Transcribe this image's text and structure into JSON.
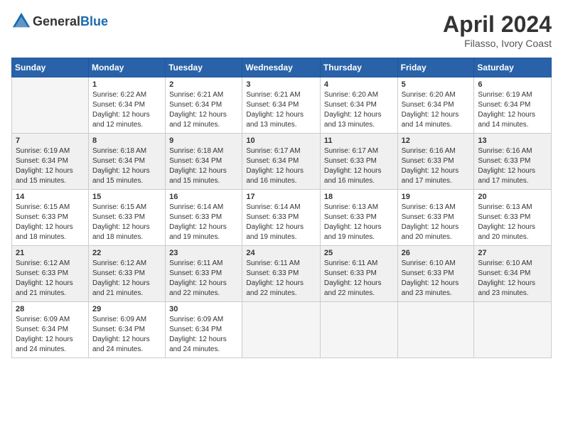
{
  "header": {
    "logo_general": "General",
    "logo_blue": "Blue",
    "month": "April 2024",
    "location": "Filasso, Ivory Coast"
  },
  "days_of_week": [
    "Sunday",
    "Monday",
    "Tuesday",
    "Wednesday",
    "Thursday",
    "Friday",
    "Saturday"
  ],
  "weeks": [
    {
      "days": [
        {
          "number": "",
          "sunrise": "",
          "sunset": "",
          "daylight": ""
        },
        {
          "number": "1",
          "sunrise": "Sunrise: 6:22 AM",
          "sunset": "Sunset: 6:34 PM",
          "daylight": "Daylight: 12 hours and 12 minutes."
        },
        {
          "number": "2",
          "sunrise": "Sunrise: 6:21 AM",
          "sunset": "Sunset: 6:34 PM",
          "daylight": "Daylight: 12 hours and 12 minutes."
        },
        {
          "number": "3",
          "sunrise": "Sunrise: 6:21 AM",
          "sunset": "Sunset: 6:34 PM",
          "daylight": "Daylight: 12 hours and 13 minutes."
        },
        {
          "number": "4",
          "sunrise": "Sunrise: 6:20 AM",
          "sunset": "Sunset: 6:34 PM",
          "daylight": "Daylight: 12 hours and 13 minutes."
        },
        {
          "number": "5",
          "sunrise": "Sunrise: 6:20 AM",
          "sunset": "Sunset: 6:34 PM",
          "daylight": "Daylight: 12 hours and 14 minutes."
        },
        {
          "number": "6",
          "sunrise": "Sunrise: 6:19 AM",
          "sunset": "Sunset: 6:34 PM",
          "daylight": "Daylight: 12 hours and 14 minutes."
        }
      ]
    },
    {
      "days": [
        {
          "number": "7",
          "sunrise": "Sunrise: 6:19 AM",
          "sunset": "Sunset: 6:34 PM",
          "daylight": "Daylight: 12 hours and 15 minutes."
        },
        {
          "number": "8",
          "sunrise": "Sunrise: 6:18 AM",
          "sunset": "Sunset: 6:34 PM",
          "daylight": "Daylight: 12 hours and 15 minutes."
        },
        {
          "number": "9",
          "sunrise": "Sunrise: 6:18 AM",
          "sunset": "Sunset: 6:34 PM",
          "daylight": "Daylight: 12 hours and 15 minutes."
        },
        {
          "number": "10",
          "sunrise": "Sunrise: 6:17 AM",
          "sunset": "Sunset: 6:34 PM",
          "daylight": "Daylight: 12 hours and 16 minutes."
        },
        {
          "number": "11",
          "sunrise": "Sunrise: 6:17 AM",
          "sunset": "Sunset: 6:33 PM",
          "daylight": "Daylight: 12 hours and 16 minutes."
        },
        {
          "number": "12",
          "sunrise": "Sunrise: 6:16 AM",
          "sunset": "Sunset: 6:33 PM",
          "daylight": "Daylight: 12 hours and 17 minutes."
        },
        {
          "number": "13",
          "sunrise": "Sunrise: 6:16 AM",
          "sunset": "Sunset: 6:33 PM",
          "daylight": "Daylight: 12 hours and 17 minutes."
        }
      ]
    },
    {
      "days": [
        {
          "number": "14",
          "sunrise": "Sunrise: 6:15 AM",
          "sunset": "Sunset: 6:33 PM",
          "daylight": "Daylight: 12 hours and 18 minutes."
        },
        {
          "number": "15",
          "sunrise": "Sunrise: 6:15 AM",
          "sunset": "Sunset: 6:33 PM",
          "daylight": "Daylight: 12 hours and 18 minutes."
        },
        {
          "number": "16",
          "sunrise": "Sunrise: 6:14 AM",
          "sunset": "Sunset: 6:33 PM",
          "daylight": "Daylight: 12 hours and 19 minutes."
        },
        {
          "number": "17",
          "sunrise": "Sunrise: 6:14 AM",
          "sunset": "Sunset: 6:33 PM",
          "daylight": "Daylight: 12 hours and 19 minutes."
        },
        {
          "number": "18",
          "sunrise": "Sunrise: 6:13 AM",
          "sunset": "Sunset: 6:33 PM",
          "daylight": "Daylight: 12 hours and 19 minutes."
        },
        {
          "number": "19",
          "sunrise": "Sunrise: 6:13 AM",
          "sunset": "Sunset: 6:33 PM",
          "daylight": "Daylight: 12 hours and 20 minutes."
        },
        {
          "number": "20",
          "sunrise": "Sunrise: 6:13 AM",
          "sunset": "Sunset: 6:33 PM",
          "daylight": "Daylight: 12 hours and 20 minutes."
        }
      ]
    },
    {
      "days": [
        {
          "number": "21",
          "sunrise": "Sunrise: 6:12 AM",
          "sunset": "Sunset: 6:33 PM",
          "daylight": "Daylight: 12 hours and 21 minutes."
        },
        {
          "number": "22",
          "sunrise": "Sunrise: 6:12 AM",
          "sunset": "Sunset: 6:33 PM",
          "daylight": "Daylight: 12 hours and 21 minutes."
        },
        {
          "number": "23",
          "sunrise": "Sunrise: 6:11 AM",
          "sunset": "Sunset: 6:33 PM",
          "daylight": "Daylight: 12 hours and 22 minutes."
        },
        {
          "number": "24",
          "sunrise": "Sunrise: 6:11 AM",
          "sunset": "Sunset: 6:33 PM",
          "daylight": "Daylight: 12 hours and 22 minutes."
        },
        {
          "number": "25",
          "sunrise": "Sunrise: 6:11 AM",
          "sunset": "Sunset: 6:33 PM",
          "daylight": "Daylight: 12 hours and 22 minutes."
        },
        {
          "number": "26",
          "sunrise": "Sunrise: 6:10 AM",
          "sunset": "Sunset: 6:33 PM",
          "daylight": "Daylight: 12 hours and 23 minutes."
        },
        {
          "number": "27",
          "sunrise": "Sunrise: 6:10 AM",
          "sunset": "Sunset: 6:34 PM",
          "daylight": "Daylight: 12 hours and 23 minutes."
        }
      ]
    },
    {
      "days": [
        {
          "number": "28",
          "sunrise": "Sunrise: 6:09 AM",
          "sunset": "Sunset: 6:34 PM",
          "daylight": "Daylight: 12 hours and 24 minutes."
        },
        {
          "number": "29",
          "sunrise": "Sunrise: 6:09 AM",
          "sunset": "Sunset: 6:34 PM",
          "daylight": "Daylight: 12 hours and 24 minutes."
        },
        {
          "number": "30",
          "sunrise": "Sunrise: 6:09 AM",
          "sunset": "Sunset: 6:34 PM",
          "daylight": "Daylight: 12 hours and 24 minutes."
        },
        {
          "number": "",
          "sunrise": "",
          "sunset": "",
          "daylight": ""
        },
        {
          "number": "",
          "sunrise": "",
          "sunset": "",
          "daylight": ""
        },
        {
          "number": "",
          "sunrise": "",
          "sunset": "",
          "daylight": ""
        },
        {
          "number": "",
          "sunrise": "",
          "sunset": "",
          "daylight": ""
        }
      ]
    }
  ]
}
